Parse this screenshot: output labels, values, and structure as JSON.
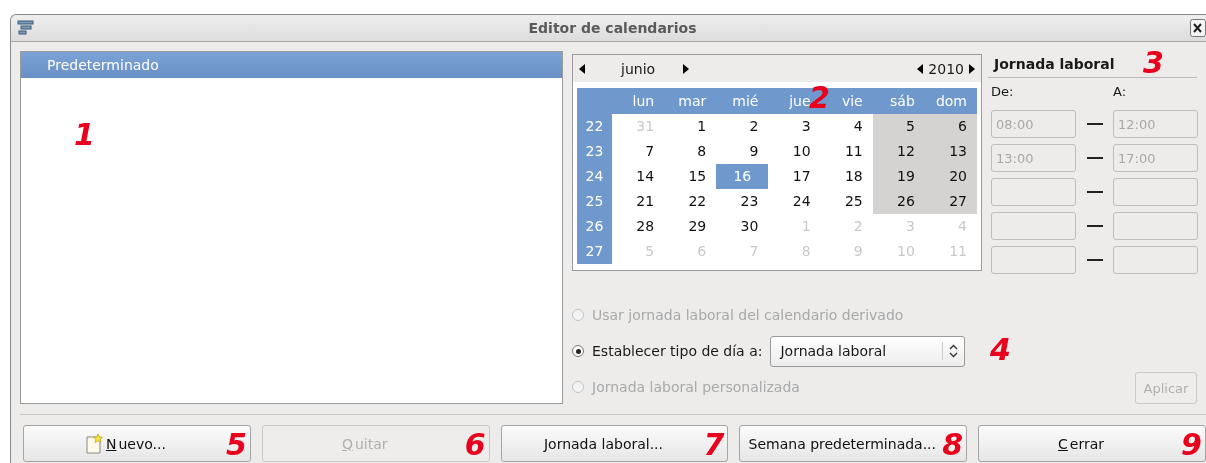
{
  "window": {
    "title": "Editor de calendarios"
  },
  "calendar_list": {
    "callout": "1",
    "items": [
      {
        "label": "Predeterminado",
        "selected": true
      }
    ]
  },
  "calendar": {
    "callout": "2",
    "month": "junio",
    "year": "2010",
    "weekdays": [
      "lun",
      "mar",
      "mié",
      "jue",
      "vie",
      "sáb",
      "dom"
    ],
    "weeks": [
      {
        "week": "22",
        "days": [
          {
            "day": "31",
            "other_month": true,
            "weekend": false,
            "selected": false
          },
          {
            "day": "1",
            "other_month": false,
            "weekend": false,
            "selected": false
          },
          {
            "day": "2",
            "other_month": false,
            "weekend": false,
            "selected": false
          },
          {
            "day": "3",
            "other_month": false,
            "weekend": false,
            "selected": false
          },
          {
            "day": "4",
            "other_month": false,
            "weekend": false,
            "selected": false
          },
          {
            "day": "5",
            "other_month": false,
            "weekend": true,
            "selected": false
          },
          {
            "day": "6",
            "other_month": false,
            "weekend": true,
            "selected": false
          }
        ]
      },
      {
        "week": "23",
        "days": [
          {
            "day": "7",
            "other_month": false,
            "weekend": false,
            "selected": false
          },
          {
            "day": "8",
            "other_month": false,
            "weekend": false,
            "selected": false
          },
          {
            "day": "9",
            "other_month": false,
            "weekend": false,
            "selected": false
          },
          {
            "day": "10",
            "other_month": false,
            "weekend": false,
            "selected": false
          },
          {
            "day": "11",
            "other_month": false,
            "weekend": false,
            "selected": false
          },
          {
            "day": "12",
            "other_month": false,
            "weekend": true,
            "selected": false
          },
          {
            "day": "13",
            "other_month": false,
            "weekend": true,
            "selected": false
          }
        ]
      },
      {
        "week": "24",
        "days": [
          {
            "day": "14",
            "other_month": false,
            "weekend": false,
            "selected": false
          },
          {
            "day": "15",
            "other_month": false,
            "weekend": false,
            "selected": false
          },
          {
            "day": "16",
            "other_month": false,
            "weekend": false,
            "selected": true
          },
          {
            "day": "17",
            "other_month": false,
            "weekend": false,
            "selected": false
          },
          {
            "day": "18",
            "other_month": false,
            "weekend": false,
            "selected": false
          },
          {
            "day": "19",
            "other_month": false,
            "weekend": true,
            "selected": false
          },
          {
            "day": "20",
            "other_month": false,
            "weekend": true,
            "selected": false
          }
        ]
      },
      {
        "week": "25",
        "days": [
          {
            "day": "21",
            "other_month": false,
            "weekend": false,
            "selected": false
          },
          {
            "day": "22",
            "other_month": false,
            "weekend": false,
            "selected": false
          },
          {
            "day": "23",
            "other_month": false,
            "weekend": false,
            "selected": false
          },
          {
            "day": "24",
            "other_month": false,
            "weekend": false,
            "selected": false
          },
          {
            "day": "25",
            "other_month": false,
            "weekend": false,
            "selected": false
          },
          {
            "day": "26",
            "other_month": false,
            "weekend": true,
            "selected": false
          },
          {
            "day": "27",
            "other_month": false,
            "weekend": true,
            "selected": false
          }
        ]
      },
      {
        "week": "26",
        "days": [
          {
            "day": "28",
            "other_month": false,
            "weekend": false,
            "selected": false
          },
          {
            "day": "29",
            "other_month": false,
            "weekend": false,
            "selected": false
          },
          {
            "day": "30",
            "other_month": false,
            "weekend": false,
            "selected": false
          },
          {
            "day": "1",
            "other_month": true,
            "weekend": false,
            "selected": false
          },
          {
            "day": "2",
            "other_month": true,
            "weekend": false,
            "selected": false
          },
          {
            "day": "3",
            "other_month": true,
            "weekend": false,
            "selected": false
          },
          {
            "day": "4",
            "other_month": true,
            "weekend": false,
            "selected": false
          }
        ]
      },
      {
        "week": "27",
        "days": [
          {
            "day": "5",
            "other_month": true,
            "weekend": false,
            "selected": false
          },
          {
            "day": "6",
            "other_month": true,
            "weekend": false,
            "selected": false
          },
          {
            "day": "7",
            "other_month": true,
            "weekend": false,
            "selected": false
          },
          {
            "day": "8",
            "other_month": true,
            "weekend": false,
            "selected": false
          },
          {
            "day": "9",
            "other_month": true,
            "weekend": false,
            "selected": false
          },
          {
            "day": "10",
            "other_month": true,
            "weekend": false,
            "selected": false
          },
          {
            "day": "11",
            "other_month": true,
            "weekend": false,
            "selected": false
          }
        ]
      }
    ]
  },
  "workday": {
    "title": "Jornada laboral",
    "callout": "3",
    "from_label": "De:",
    "to_label": "A:",
    "disabled": true,
    "slots": [
      {
        "kind": "filled",
        "from": "08:00",
        "to": "12:00"
      },
      {
        "kind": "filled",
        "from": "13:00",
        "to": "17:00"
      },
      {
        "kind": "empty"
      },
      {
        "kind": "empty"
      },
      {
        "kind": "empty"
      }
    ],
    "apply_button": {
      "label": "Aplicar",
      "disabled": true
    }
  },
  "day_type": {
    "callout": "4",
    "options": [
      {
        "kind": "plain",
        "label": "Usar jornada laboral del calendario derivado",
        "selected": false,
        "disabled": true
      },
      {
        "kind": "select",
        "label": "Establecer tipo de día a:",
        "selected": true,
        "disabled": false,
        "value": "Jornada laboral"
      },
      {
        "kind": "plain",
        "label": "Jornada laboral personalizada",
        "selected": false,
        "disabled": true
      }
    ]
  },
  "buttons": [
    {
      "label": "Nuevo...",
      "callout": "5",
      "icon": true,
      "disabled": false,
      "underline_first": true
    },
    {
      "label": "Quitar",
      "callout": "6",
      "icon": false,
      "disabled": true,
      "underline_first": true
    },
    {
      "label": "Jornada laboral...",
      "callout": "7",
      "icon": false,
      "disabled": false,
      "underline_first": false
    },
    {
      "label": "Semana predeterminada...",
      "callout": "8",
      "icon": false,
      "disabled": false,
      "underline_first": false
    },
    {
      "label": "Cerrar",
      "callout": "9",
      "icon": false,
      "disabled": false,
      "underline_first": true
    }
  ]
}
